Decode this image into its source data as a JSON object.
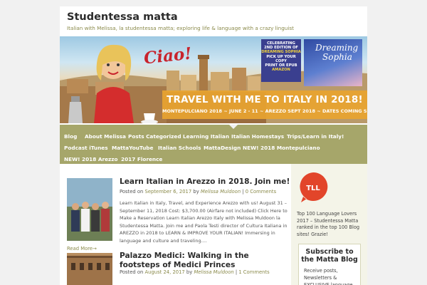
{
  "site": {
    "title": "Studentessa matta",
    "description": "Italian with Melissa, la studentessa matta; exploring life & language with a crazy linguist"
  },
  "banner": {
    "greeting": "Ciao!",
    "celebrate_lines": [
      "CELEBRATING",
      "2ND EDITION OF",
      "DREAMING SOPHIA",
      "PICK UP YOUR COPY",
      "PRINT OR EPUB",
      "AMAZON"
    ],
    "book_title": [
      "Dreaming",
      "Sophia"
    ],
    "travel_headline": "TRAVEL WITH ME TO ITALY IN 2018!",
    "travel_dates": "MONTEPULCIANO 2018 ~ JUNE 2 - 11 ~ AREZZO SEPT 2018 ~ DATES COMING SOON"
  },
  "nav": {
    "items": [
      "Blog",
      "About Melissa",
      "Posts Categorized",
      "Learning Italian",
      "Italian Homestays",
      "Trips/Learn in Italy!",
      "Podcast iTunes",
      "MattaYouTube",
      "Italian Schools",
      "MattaDesign",
      "NEW! 2018 Montepulciano",
      "NEW! 2018 Arezzo",
      "2017 Florence"
    ]
  },
  "posts": [
    {
      "title": "Learn Italian in Arezzo in 2018. Join me!",
      "posted_on": "Posted on",
      "date": "September 6, 2017",
      "by": "by",
      "author": "Melissa Muldoon",
      "separator": "|",
      "comments": "0 Comments",
      "excerpt": "Learn Italian in Italy, Travel, and Experience Arezzo with us! August 31 – September 11, 2018 Cost: $3,700.00 (Airfare not included) Click Here to Make a Reservation Learn Italian Arezzo Italy with Melissa Muldoon la Studentessa Matta. Join me and Paola Testi director of Cultura Italiana in AREZZO in 2018 to LEARN & IMPROVE YOUR ITALIAN! Immersing in language and culture and traveling....",
      "read_more": "Read More→"
    },
    {
      "title": "Palazzo Medici: Walking in the footsteps of Medici Princes",
      "posted_on": "Posted on",
      "date": "August 24, 2017",
      "by": "by",
      "author": "Melissa Muldoon",
      "separator": "|",
      "comments": "1 Comments"
    }
  ],
  "sidebar": {
    "badge_text": "TLL",
    "award_text": "Top 100 Language Lovers 2017 – Studentessa Matta ranked in the top 100 Blog sites! Grazie!",
    "subscribe_title": "Subscribe to the Matta Blog",
    "subscribe_text": "Receive posts, Newsletters & EXCLUSIVE language"
  },
  "colors": {
    "nav_background": "#a6a66a",
    "accent_olive": "#8a8a4a",
    "page_background": "#f1f1f1",
    "badge_red": "#e2452a"
  }
}
